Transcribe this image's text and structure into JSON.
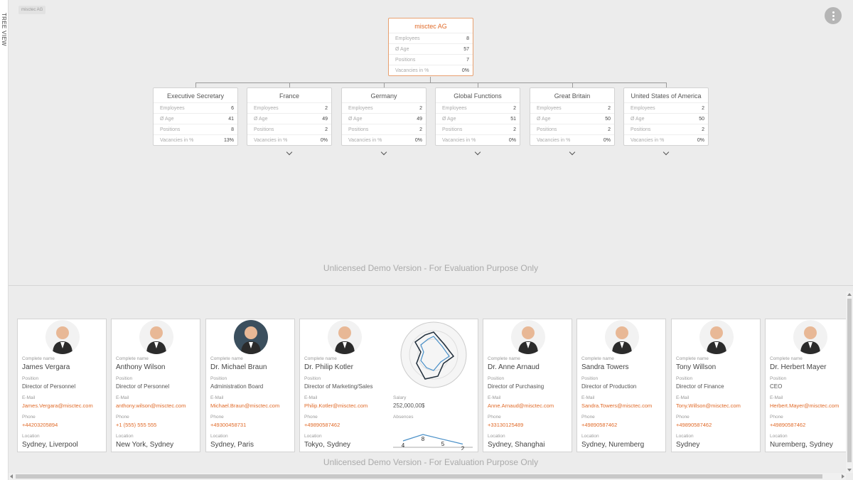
{
  "side_tab": "TREE VIEW",
  "breadcrumb": "misctec AG",
  "tree": {
    "root": {
      "title": "misctec AG",
      "rows": [
        {
          "label": "Employees",
          "value": "8"
        },
        {
          "label": "Ø Age",
          "value": "57"
        },
        {
          "label": "Positions",
          "value": "7"
        },
        {
          "label": "Vacancies in %",
          "value": "0%"
        }
      ]
    },
    "children": [
      {
        "title": "Executive Secretary",
        "rows": [
          {
            "label": "Employees",
            "value": "6"
          },
          {
            "label": "Ø Age",
            "value": "41"
          },
          {
            "label": "Positions",
            "value": "8"
          },
          {
            "label": "Vacancies in %",
            "value": "13%"
          }
        ]
      },
      {
        "title": "France",
        "rows": [
          {
            "label": "Employees",
            "value": "2"
          },
          {
            "label": "Ø Age",
            "value": "49"
          },
          {
            "label": "Positions",
            "value": "2"
          },
          {
            "label": "Vacancies in %",
            "value": "0%"
          }
        ]
      },
      {
        "title": "Germany",
        "rows": [
          {
            "label": "Employees",
            "value": "2"
          },
          {
            "label": "Ø Age",
            "value": "49"
          },
          {
            "label": "Positions",
            "value": "2"
          },
          {
            "label": "Vacancies in %",
            "value": "0%"
          }
        ]
      },
      {
        "title": "Global Functions",
        "rows": [
          {
            "label": "Employees",
            "value": "2"
          },
          {
            "label": "Ø Age",
            "value": "51"
          },
          {
            "label": "Positions",
            "value": "2"
          },
          {
            "label": "Vacancies in %",
            "value": "0%"
          }
        ]
      },
      {
        "title": "Great Britain",
        "rows": [
          {
            "label": "Employees",
            "value": "2"
          },
          {
            "label": "Ø Age",
            "value": "50"
          },
          {
            "label": "Positions",
            "value": "2"
          },
          {
            "label": "Vacancies in %",
            "value": "0%"
          }
        ]
      },
      {
        "title": "United States of America",
        "rows": [
          {
            "label": "Employees",
            "value": "2"
          },
          {
            "label": "Ø Age",
            "value": "50"
          },
          {
            "label": "Positions",
            "value": "2"
          },
          {
            "label": "Vacancies in %",
            "value": "0%"
          }
        ]
      }
    ]
  },
  "watermark": "Unlicensed Demo Version - For Evaluation Purpose Only",
  "labels": {
    "name": "Complete name",
    "position": "Position",
    "email": "E-Mail",
    "phone": "Phone",
    "location": "Location",
    "salary": "Salary",
    "absences": "Absences"
  },
  "employees": [
    {
      "name": "James Vergara",
      "position": "Director of Personnel",
      "email": "James.Vergara@misctec.com",
      "phone": "+44203205894",
      "location": "Sydney, Liverpool"
    },
    {
      "name": "Anthony Wilson",
      "position": "Director of Personnel",
      "email": "anthony.wilson@misctec.com",
      "phone": "+1 (555) 555 555",
      "location": "New York, Sydney"
    },
    {
      "name": "Dr. Michael Braun",
      "position": "Administration Board",
      "email": "Michael.Braun@misctec.com",
      "phone": "+49300458731",
      "location": "Sydney, Paris"
    },
    {
      "name": "Dr. Philip Kotler",
      "position": "Director of Marketing/Sales",
      "email": "Philip.Kotler@misctec.com",
      "phone": "+49890587462",
      "location": "Tokyo, Sydney",
      "salary": "252,000,00$",
      "absences": [
        4,
        8,
        5,
        2
      ]
    },
    {
      "name": "Dr. Anne Arnaud",
      "position": "Director of Purchasing",
      "email": "Anne.Arnaud@misctec.com",
      "phone": "+33130125489",
      "location": "Sydney, Shanghai"
    },
    {
      "name": "Sandra Towers",
      "position": "Director of Production",
      "email": "Sandra.Towers@misctec.com",
      "phone": "+49890587462",
      "location": "Sydney, Nuremberg"
    },
    {
      "name": "Tony Willson",
      "position": "Director of Finance",
      "email": "Tony.Willson@misctec.com",
      "phone": "+49890587462",
      "location": "Sydney"
    },
    {
      "name": "Dr. Herbert Mayer",
      "position": "CEO",
      "email": "Herbert.Mayer@misctec.com",
      "phone": "+49890587462",
      "location": "Nuremberg, Sydney"
    }
  ],
  "colors": {
    "accent": "#e06a28",
    "radar_dark": "#1f2d3a",
    "radar_blue": "#4a90c8"
  }
}
